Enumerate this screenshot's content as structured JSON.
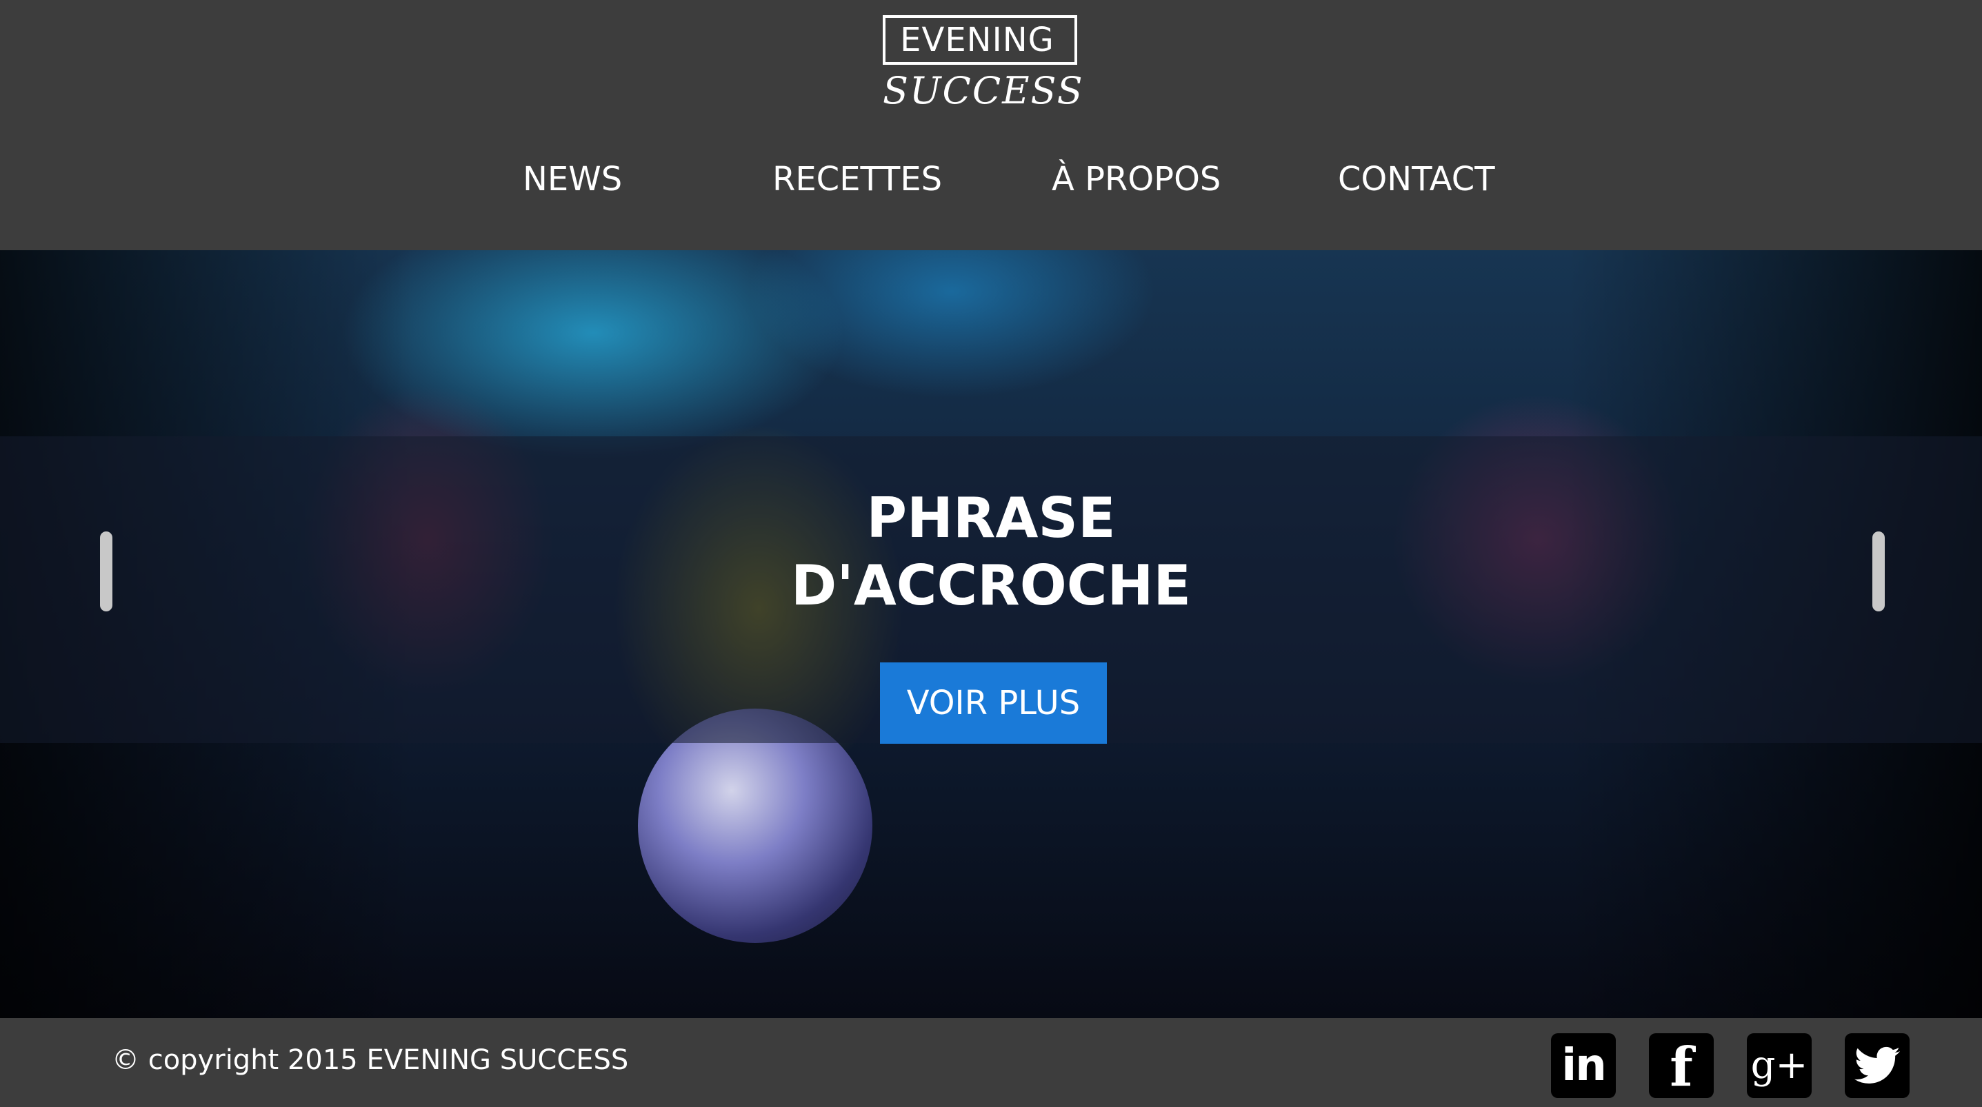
{
  "logo": {
    "top_text": "EVENING",
    "bottom_text": "SUCCESS"
  },
  "nav": {
    "items": [
      {
        "label": "NEWS"
      },
      {
        "label": "RECETTES"
      },
      {
        "label": "À PROPOS"
      },
      {
        "label": "CONTACT"
      }
    ]
  },
  "hero": {
    "tagline_line1": "PHRASE",
    "tagline_line2": "D'ACCROCHE",
    "cta_label": "VOIR PLUS",
    "image_icon": "dance-party-photo",
    "prev_icon": "slider-prev-handle",
    "next_icon": "slider-next-handle"
  },
  "footer": {
    "copyright": "© copyright 2015 EVENING SUCCESS",
    "social": [
      {
        "icon": "linkedin-icon",
        "glyph": "in"
      },
      {
        "icon": "facebook-icon",
        "glyph": "f"
      },
      {
        "icon": "google-plus-icon",
        "glyph": "g+"
      },
      {
        "icon": "twitter-icon",
        "glyph": ""
      }
    ]
  },
  "colors": {
    "header_bg": "#3d3d3d",
    "cta_bg": "#1a7ad8",
    "text": "#ffffff",
    "social_bg": "#000000"
  }
}
